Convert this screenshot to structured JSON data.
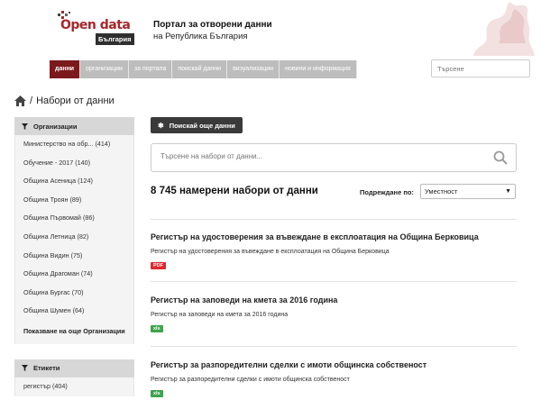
{
  "header": {
    "logo_text": "Open data",
    "logo_sub": "България",
    "portal_title": "Портал за отворени данни",
    "portal_sub": "на Република България"
  },
  "nav": {
    "items": [
      {
        "label": "данни",
        "active": true
      },
      {
        "label": "организации",
        "active": false
      },
      {
        "label": "за портала",
        "active": false
      },
      {
        "label": "поискай данни",
        "active": false
      },
      {
        "label": "визуализации",
        "active": false
      },
      {
        "label": "новини и информация",
        "active": false
      }
    ],
    "search_placeholder": "Търсене"
  },
  "breadcrumb": {
    "current": "Набори от данни",
    "separator": "/"
  },
  "sidebar": {
    "organizations": {
      "title": "Организации",
      "items": [
        "Министерство на обр... (414)",
        "Обучение - 2017 (140)",
        "Община Асеница (124)",
        "Община Троян (89)",
        "Община Първомай (86)",
        "Община Летница (82)",
        "Община Видин (75)",
        "Община Драгоман (74)",
        "Община Бургас (70)",
        "Община Шумен (64)"
      ],
      "more": "Показване на още Организации"
    },
    "tags": {
      "title": "Етикети",
      "items": [
        "регистър (404)"
      ]
    }
  },
  "main": {
    "request_button": "Поискай още данни",
    "search_placeholder": "Търсене на набори от данни...",
    "result_count": "8 745 намерени набори от данни",
    "sort_label": "Подреждане по:",
    "sort_value": "Уместност",
    "datasets": [
      {
        "title": "Регистър на удостоверения за въвеждане в експлоатация на Община Берковица",
        "description": "Регистър на удостоверения за въвеждане в експлоатация на Община Берковица",
        "format": "PDF"
      },
      {
        "title": "Регистър на заповеди на кмета за 2016 година",
        "description": "Регистър на заповеди на кмета за 2016 година",
        "format": "xls"
      },
      {
        "title": "Регистър за разпоредителни сделки с имоти общинска собственост",
        "description": "Регистър за разпоредителни сделки с имоти общинска собственост",
        "format": "xls"
      }
    ]
  },
  "colors": {
    "brand": "#a8262b",
    "nav_active": "#7a1a1d",
    "nav_inactive": "#bdbdbd",
    "pdf_badge": "#e0272e",
    "xls_badge": "#3ea34c"
  },
  "icons": [
    "home-icon",
    "filter-icon",
    "star-icon",
    "search-icon",
    "caret-down-icon",
    "lion-coat-of-arms"
  ]
}
